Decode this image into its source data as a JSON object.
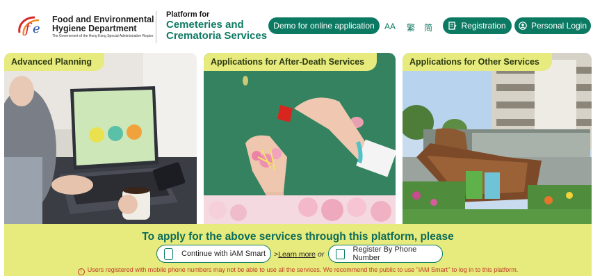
{
  "header": {
    "dept_title_line1": "Food and Environmental",
    "dept_title_line2": "Hygiene Department",
    "dept_subtitle": "The Government of the Hong Kong Special Administrative Region",
    "platform_for": "Platform for",
    "platform_name_line1": "Cemeteries and",
    "platform_name_line2": "Crematoria Services",
    "demo_label": "Demo for online application",
    "font_size_toggle": "AA",
    "lang_tc": "繁",
    "lang_sc": "简",
    "registration_label": "Registration",
    "login_label": "Personal Login"
  },
  "cards": [
    {
      "label": "Advanced Planning"
    },
    {
      "label": "Applications for After-Death Services"
    },
    {
      "label": "Applications for Other Services"
    }
  ],
  "apply": {
    "title": "To apply for the above services through this platform, please",
    "iam_smart_label": "Continue with iAM Smart",
    "learn_more_label": "Learn more",
    "learn_more_prefix": ">",
    "or_label": "or",
    "phone_label": "Register By Phone Number",
    "notice": "Users registered with mobile phone numbers may not be able to use all the services. We recommend the public to use \"iAM Smart\" to log in to this platform."
  },
  "colors": {
    "brand_green": "#0c7a63",
    "accent_yellow": "#e7ea7c",
    "warning_red": "#c0392b"
  }
}
